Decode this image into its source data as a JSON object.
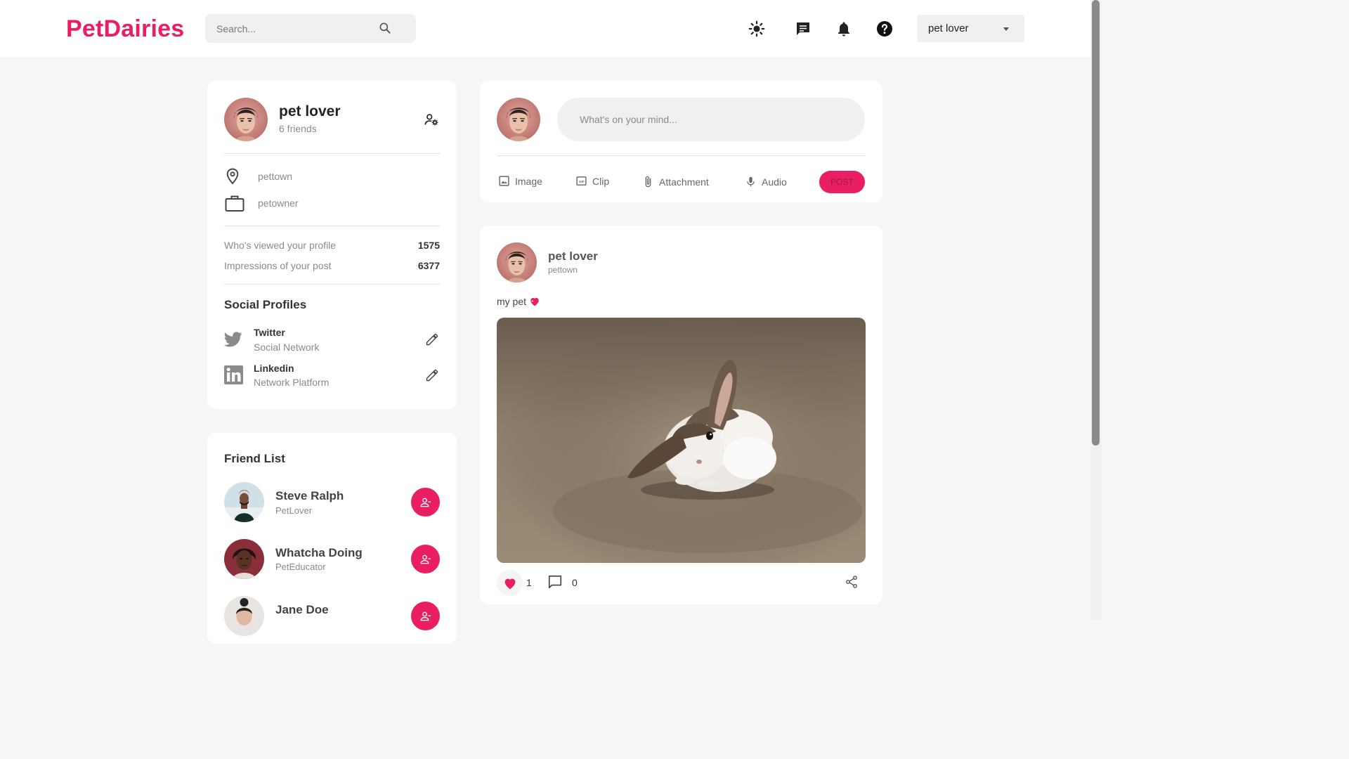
{
  "header": {
    "logo": "PetDairies",
    "search_placeholder": "Search...",
    "user_menu": "pet lover"
  },
  "profile": {
    "name": "pet lover",
    "friends": "6 friends",
    "location": "pettown",
    "occupation": "petowner",
    "stats": [
      {
        "label": "Who's viewed your profile",
        "value": "1575"
      },
      {
        "label": "Impressions of your post",
        "value": "6377"
      }
    ],
    "social_title": "Social Profiles",
    "social": [
      {
        "name": "Twitter",
        "type": "Social Network"
      },
      {
        "name": "Linkedin",
        "type": "Network Platform"
      }
    ]
  },
  "friends": {
    "title": "Friend List",
    "items": [
      {
        "name": "Steve Ralph",
        "role": "PetLover"
      },
      {
        "name": "Whatcha Doing",
        "role": "PetEducator"
      },
      {
        "name": "Jane Doe",
        "role": ""
      }
    ]
  },
  "composer": {
    "placeholder": "What's on your mind...",
    "actions": [
      "Image",
      "Clip",
      "Attachment",
      "Audio"
    ],
    "post_label": "POST"
  },
  "post": {
    "author": "pet lover",
    "location": "pettown",
    "text": "my pet",
    "likes": "1",
    "comments": "0"
  },
  "colors": {
    "accent": "#e91e63",
    "background": "#f6f6f6",
    "card": "#ffffff"
  }
}
